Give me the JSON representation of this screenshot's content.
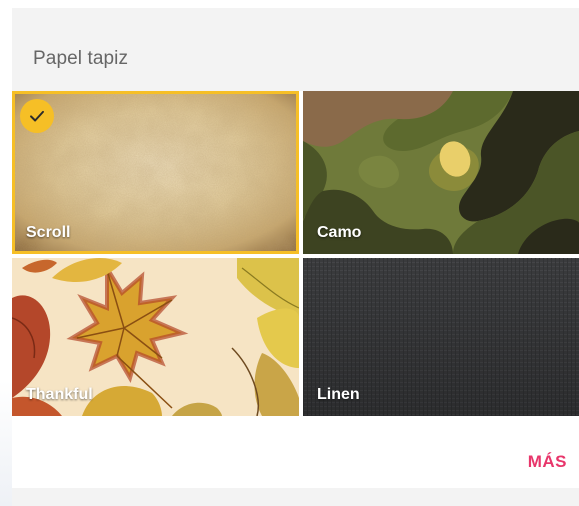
{
  "dialog": {
    "title": "Papel tapiz"
  },
  "wallpapers": [
    {
      "label": "Scroll",
      "selected": true
    },
    {
      "label": "Camo",
      "selected": false
    },
    {
      "label": "Thankful",
      "selected": false
    },
    {
      "label": "Linen",
      "selected": false
    }
  ],
  "footer": {
    "more_label": "MÁS"
  },
  "colors": {
    "selection": "#f6bf26",
    "accent": "#e8366b",
    "title_text": "#666666",
    "dialog_bg": "#f3f3f3"
  },
  "icons": {
    "selected_indicator": "checkmark-icon"
  }
}
